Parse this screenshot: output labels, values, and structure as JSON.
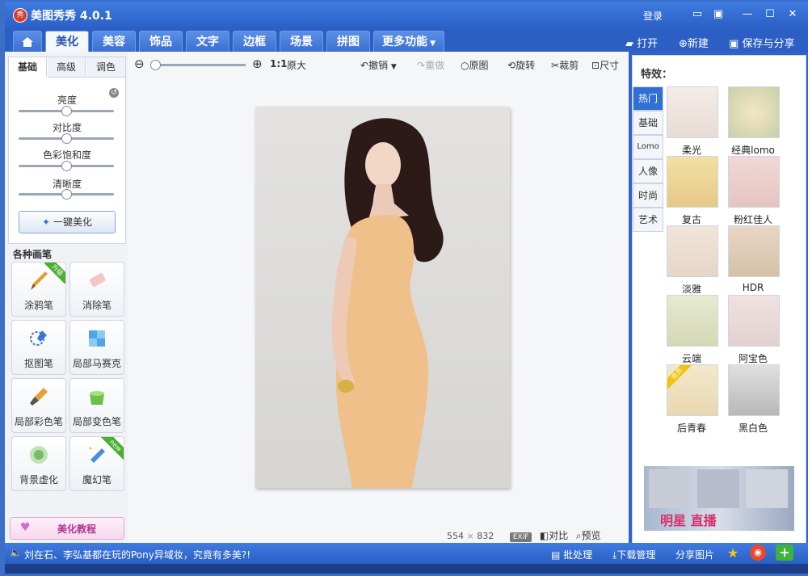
{
  "app": {
    "title": "美图秀秀 4.0.1",
    "logo_text": "秀",
    "login": "登录"
  },
  "main_tabs": [
    {
      "label": "美化",
      "active": true
    },
    {
      "label": "美容"
    },
    {
      "label": "饰品"
    },
    {
      "label": "文字"
    },
    {
      "label": "边框"
    },
    {
      "label": "场景"
    },
    {
      "label": "拼图"
    },
    {
      "label": "更多功能"
    }
  ],
  "actions": {
    "open": "打开",
    "new": "新建",
    "save": "保存与分享"
  },
  "adjust": {
    "tabs": [
      "基础",
      "高级",
      "调色"
    ],
    "sliders": [
      {
        "label": "亮度",
        "value": 0.5
      },
      {
        "label": "对比度",
        "value": 0.5
      },
      {
        "label": "色彩饱和度",
        "value": 0.5
      },
      {
        "label": "清晰度",
        "value": 0.5
      }
    ],
    "one_key": "一键美化"
  },
  "brushes": {
    "title": "各种画笔",
    "items": [
      {
        "label": "涂鸦笔",
        "badge": "升级"
      },
      {
        "label": "消除笔"
      },
      {
        "label": "抠图笔"
      },
      {
        "label": "局部马赛克"
      },
      {
        "label": "局部彩色笔"
      },
      {
        "label": "局部变色笔"
      },
      {
        "label": "背景虚化"
      },
      {
        "label": "魔幻笔",
        "badge": "new"
      }
    ]
  },
  "tutorial": "美化教程",
  "toolbar": {
    "ratio": "1:1",
    "original_size": "原大",
    "undo": "撤销",
    "redo": "重做",
    "original": "原图",
    "rotate": "旋转",
    "crop": "裁剪",
    "size": "尺寸"
  },
  "canvas": {
    "width": "554",
    "times": "×",
    "height": "832",
    "exif": "EXIF",
    "compare": "对比",
    "preview": "预览"
  },
  "effects": {
    "title": "特效：",
    "categories": [
      "热门",
      "基础",
      "Lomo",
      "人像",
      "时尚",
      "艺术"
    ],
    "items": [
      {
        "label": "柔光"
      },
      {
        "label": "经典lomo"
      },
      {
        "label": "复古"
      },
      {
        "label": "粉红佳人"
      },
      {
        "label": "淡雅"
      },
      {
        "label": "HDR"
      },
      {
        "label": "云端"
      },
      {
        "label": "阿宝色"
      },
      {
        "label": "后青春",
        "badge": "会员"
      },
      {
        "label": "黑白色"
      }
    ],
    "banner_text": "明星 直播"
  },
  "status": {
    "news": "刘在石、李弘基都在玩的Pony异域妆，究竟有多美?!",
    "batch": "批处理",
    "download": "下载管理",
    "share": "分享图片"
  }
}
